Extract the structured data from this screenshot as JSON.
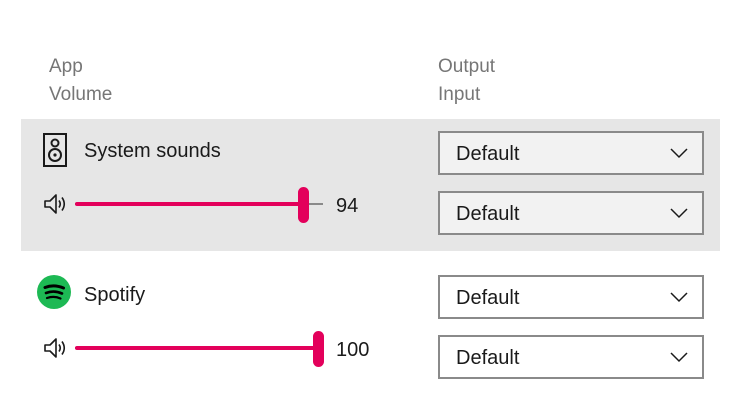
{
  "headers": {
    "left_line1": "App",
    "left_line2": "Volume",
    "right_line1": "Output",
    "right_line2": "Input"
  },
  "apps": [
    {
      "name": "System sounds",
      "icon": "speaker-device-icon",
      "volume": 94,
      "volume_label": "94",
      "output": "Default",
      "input": "Default",
      "selected": true
    },
    {
      "name": "Spotify",
      "icon": "spotify-logo-icon",
      "volume": 100,
      "volume_label": "100",
      "output": "Default",
      "input": "Default",
      "selected": false
    }
  ],
  "colors": {
    "accent": "#e3005b",
    "selected_row_bg": "#e6e6e6",
    "header_text": "#767676",
    "spotify_green": "#1db954"
  }
}
